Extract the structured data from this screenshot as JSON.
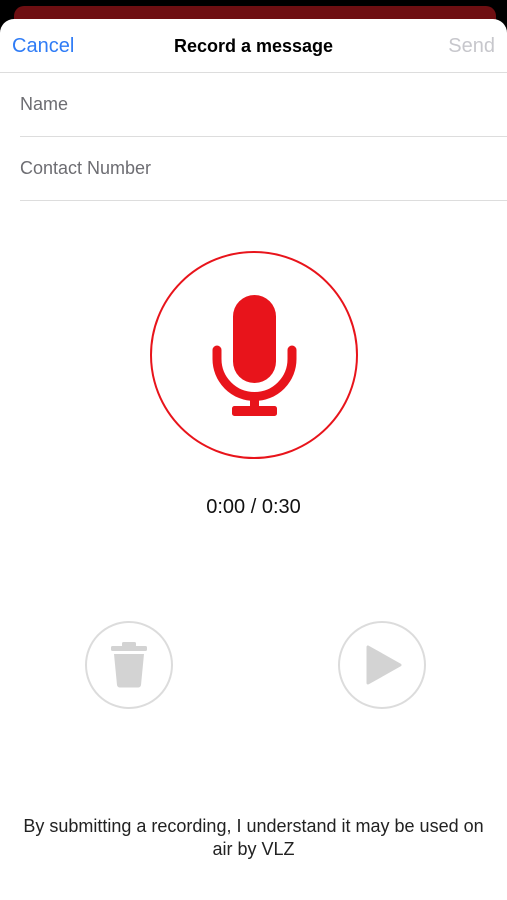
{
  "header": {
    "cancel_label": "Cancel",
    "title": "Record a message",
    "send_label": "Send"
  },
  "form": {
    "name_placeholder": "Name",
    "name_value": "",
    "contact_placeholder": "Contact Number",
    "contact_value": ""
  },
  "recorder": {
    "icon": "microphone-icon",
    "elapsed": "0:00",
    "separator": " / ",
    "duration": "0:30"
  },
  "controls": {
    "delete_icon": "trash-icon",
    "play_icon": "play-icon"
  },
  "disclaimer": "By submitting a recording, I understand it may be used on air by VLZ",
  "colors": {
    "accent_red": "#e8141b",
    "link_blue": "#2f7cf6",
    "disabled_gray": "#c7c7cc",
    "control_gray": "#dcdcdc"
  }
}
